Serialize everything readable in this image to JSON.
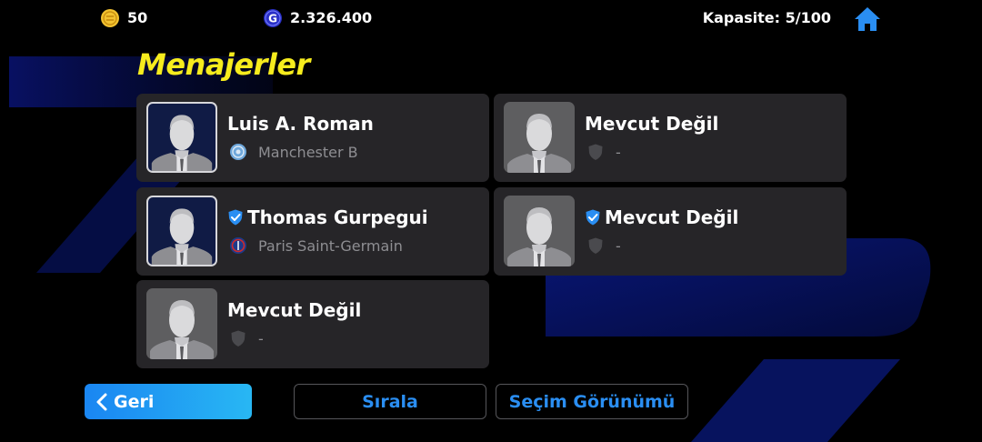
{
  "topbar": {
    "coins_value": "50",
    "gp_value": "2.326.400",
    "capacity": "Kapasite: 5/100",
    "home_icon": "home-icon"
  },
  "page": {
    "title": "Menajerler"
  },
  "managers": [
    {
      "name": "Luis A. Roman",
      "club": "Manchester B",
      "selected": false
    },
    {
      "name": "Mevcut Değil",
      "club": "-",
      "selected": false
    },
    {
      "name": "Thomas Gurpegui",
      "club": "Paris Saint-Germain",
      "selected": true
    },
    {
      "name": "Mevcut Değil",
      "club": "-",
      "selected": true
    },
    {
      "name": "Mevcut Değil",
      "club": "-",
      "selected": false
    }
  ],
  "buttons": {
    "back": "Geri",
    "sort": "Sırala",
    "view": "Seçim Görünümü"
  },
  "colors": {
    "title": "#f6ec1d",
    "accent": "#2a8ef2",
    "card": "#262528",
    "check": "#2a8ef2"
  }
}
